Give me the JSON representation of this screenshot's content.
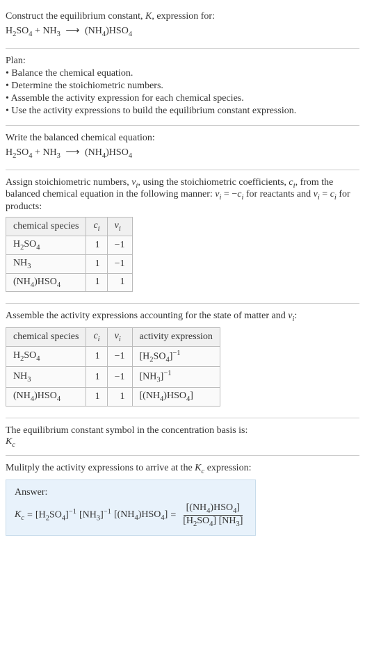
{
  "header": {
    "prompt": "Construct the equilibrium constant, ",
    "Ksym": "K",
    "prompt2": ", expression for:"
  },
  "equation": {
    "r1_base": "H",
    "r1_sub1": "2",
    "r1_mid": "SO",
    "r1_sub2": "4",
    "plus1": " + ",
    "r2_base": "NH",
    "r2_sub": "3",
    "arrow": "⟶",
    "p1_a": "(NH",
    "p1_sub1": "4",
    "p1_b": ")HSO",
    "p1_sub2": "4"
  },
  "plan": {
    "title": "Plan:",
    "items": [
      "• Balance the chemical equation.",
      "• Determine the stoichiometric numbers.",
      "• Assemble the activity expression for each chemical species.",
      "• Use the activity expressions to build the equilibrium constant expression."
    ]
  },
  "balanced": {
    "title": "Write the balanced chemical equation:"
  },
  "stoich": {
    "intro1": "Assign stoichiometric numbers, ",
    "nu": "ν",
    "i": "i",
    "intro2": ", using the stoichiometric coefficients, ",
    "c": "c",
    "intro3": ", from the balanced chemical equation in the following manner: ",
    "eq1": " = −",
    "intro4": " for reactants and ",
    "eq2": " = ",
    "intro5": " for products:",
    "headers": {
      "species": "chemical species",
      "ci": "c",
      "nui": "ν"
    },
    "rows": [
      {
        "species_html": "H2SO4",
        "ci": "1",
        "nui": "−1"
      },
      {
        "species_html": "NH3",
        "ci": "1",
        "nui": "−1"
      },
      {
        "species_html": "(NH4)HSO4",
        "ci": "1",
        "nui": "1"
      }
    ]
  },
  "activity": {
    "intro1": "Assemble the activity expressions accounting for the state of matter and ",
    "intro2": ":",
    "headers": {
      "species": "chemical species",
      "ci": "c",
      "nui": "ν",
      "act": "activity expression"
    },
    "rows": [
      {
        "ci": "1",
        "nui": "−1"
      },
      {
        "ci": "1",
        "nui": "−1"
      },
      {
        "ci": "1",
        "nui": "1"
      }
    ]
  },
  "basis": {
    "line": "The equilibrium constant symbol in the concentration basis is:",
    "sym": "K",
    "sub": "c"
  },
  "multiply": {
    "line1": "Mulitply the activity expressions to arrive at the ",
    "line2": " expression:"
  },
  "answer": {
    "label": "Answer:",
    "eq": " = ",
    "eq2": " = ",
    "neg1": "−1"
  },
  "species": {
    "h2so4_open": "[H",
    "h2so4_mid": "SO",
    "h2so4_close": "]",
    "nh3_open": "[NH",
    "nh3_close": "]",
    "nh4hso4_open": "[(NH",
    "nh4hso4_mid": ")HSO",
    "nh4hso4_close": "]",
    "two": "2",
    "three": "3",
    "four": "4"
  }
}
